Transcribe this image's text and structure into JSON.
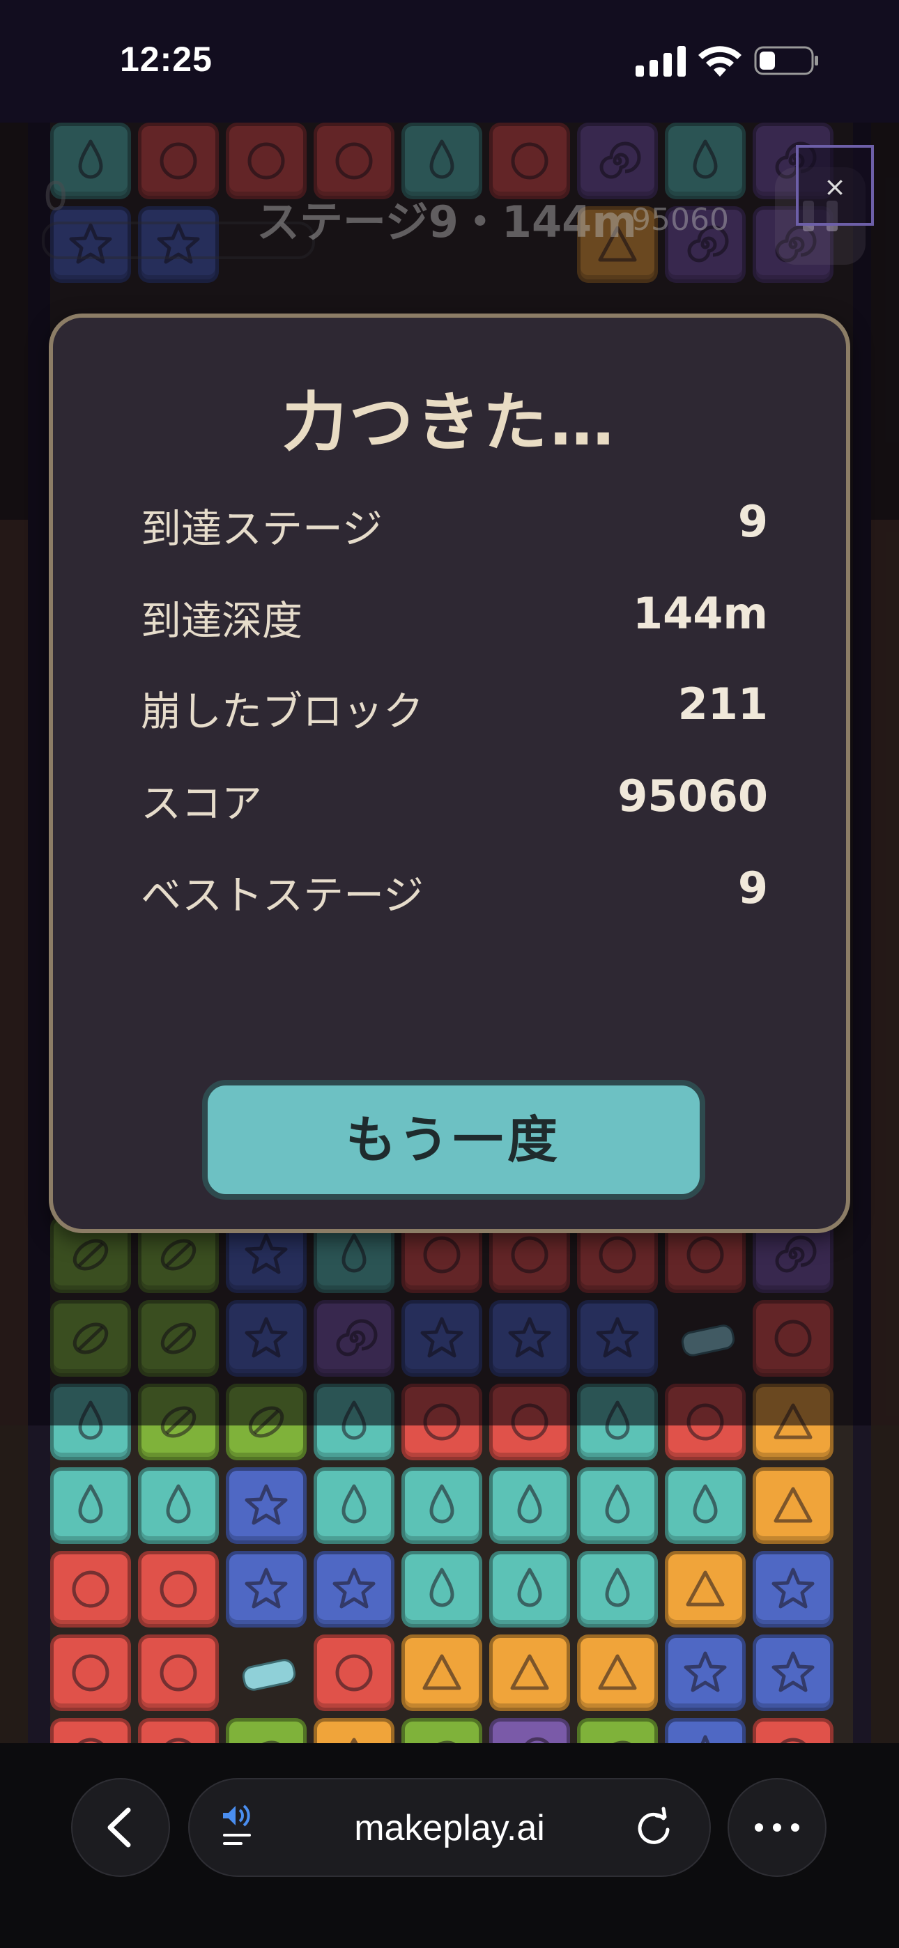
{
  "status_bar": {
    "time": "12:25",
    "icons": [
      "cellular-signal-icon",
      "wifi-icon",
      "battery-icon"
    ]
  },
  "hud": {
    "score": "0",
    "stage_depth": "ステージ9・144m",
    "best_score": "95060"
  },
  "close_button": {
    "label": "×"
  },
  "modal": {
    "title": "力つきた…",
    "rows": [
      {
        "label": "到達ステージ",
        "value": "9"
      },
      {
        "label": "到達深度",
        "value": "144m"
      },
      {
        "label": "崩したブロック",
        "value": "211"
      },
      {
        "label": "スコア",
        "value": "95060"
      },
      {
        "label": "ベストステージ",
        "value": "9"
      }
    ],
    "retry_label": "もう一度"
  },
  "browser": {
    "url": "makeplay.ai",
    "icons": [
      "back-chevron-icon",
      "speaker-icon",
      "reload-icon",
      "more-dots-icon"
    ]
  },
  "colors": {
    "red": "#e0524a",
    "teal": "#5cc2b6",
    "blue": "#4f68c4",
    "orange": "#f0a43a",
    "green": "#7fb23a",
    "purple": "#7a5aa8",
    "modal_bg": "#2e2833",
    "modal_border": "#8c7d66",
    "retry_bg": "#6dc1c3"
  },
  "board": {
    "rows": [
      [
        "teal",
        "red",
        "red",
        "red",
        "teal",
        "red",
        "spiral",
        "teal",
        "spiral"
      ],
      [
        "blue",
        "blue",
        "empty",
        "empty",
        "empty",
        "empty",
        "orange",
        "spiral",
        "spiral"
      ],
      [
        "green",
        "green",
        "blue",
        "teal",
        "red",
        "red",
        "red",
        "red",
        "purple"
      ],
      [
        "green",
        "green",
        "blue",
        "spiral",
        "blue",
        "blue",
        "blue",
        "capsule",
        "red"
      ],
      [
        "teal",
        "green",
        "green",
        "teal",
        "red",
        "red",
        "teal",
        "red",
        "orange"
      ],
      [
        "teal",
        "teal",
        "blue",
        "teal",
        "teal",
        "teal",
        "teal",
        "teal",
        "orange"
      ],
      [
        "red",
        "red",
        "blue",
        "blue",
        "teal",
        "teal",
        "teal",
        "orange",
        "blue"
      ],
      [
        "red",
        "red",
        "capsule",
        "red",
        "orange",
        "orange",
        "orange",
        "blue",
        "blue"
      ],
      [
        "red",
        "red",
        "green",
        "orange",
        "green",
        "purple",
        "green",
        "blue",
        "red"
      ]
    ]
  }
}
